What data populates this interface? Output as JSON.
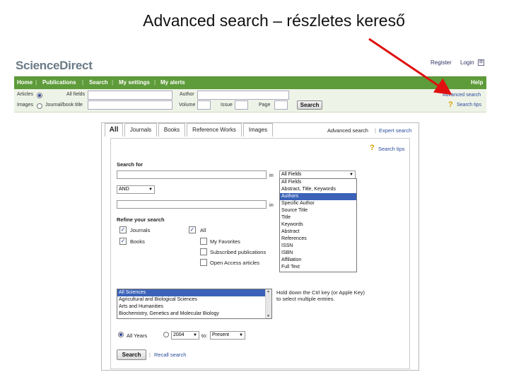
{
  "slide_title": "Advanced search – részletes kereső",
  "brand": {
    "logo_text": "ScienceDirect"
  },
  "top_links": {
    "register": "Register",
    "login": "Login"
  },
  "nav": {
    "items": [
      "Home",
      "Publications",
      "Search",
      "My settings",
      "My alerts"
    ],
    "help": "Help"
  },
  "quick_search": {
    "articles_label": "Articles",
    "images_label": "Images",
    "all_fields_label": "All fields",
    "journal_label": "Journal/book title",
    "author_label": "Author",
    "volume_label": "Volume",
    "issue_label": "Issue",
    "page_label": "Page",
    "search_button": "Search",
    "advanced_search_link": "Advanced search",
    "search_tips_link": "Search tips"
  },
  "tabs": [
    "All",
    "Journals",
    "Books",
    "Reference Works",
    "Images"
  ],
  "right_links": {
    "advanced": "Advanced search",
    "expert": "Expert search"
  },
  "form": {
    "search_tips": "Search tips",
    "search_for_label": "Search for",
    "in_label_1": "in",
    "in_label_2": "in",
    "field_select_value": "All Fields",
    "operator_value": "AND",
    "field_options": [
      "All Fields",
      "Abstract, Title, Keywords",
      "Authors",
      "Specific Author",
      "Source Title",
      "Title",
      "Keywords",
      "Abstract",
      "References",
      "ISSN",
      "ISBN",
      "Affiliation",
      "Full Text"
    ],
    "selected_field_index": 2,
    "refine_label": "Refine your search",
    "journals_label": "Journals",
    "books_label": "Books",
    "all_label": "All",
    "my_favorites_label": "My Favorites",
    "subscribed_label": "Subscribed publications",
    "open_access_label": "Open Access articles",
    "subjects": [
      "All Sciences",
      "Agricultural and Biological Sciences",
      "Arts and Humanities",
      "Biochemistry, Genetics and Molecular Biology"
    ],
    "hold_note_1": "Hold down the Ctrl key (or Apple Key)",
    "hold_note_2": "to select multiple entries.",
    "all_years_label": "All Years",
    "year_from": "2004",
    "to_label": "to:",
    "year_to": "Present",
    "search_button": "Search",
    "recall_link": "Recall search"
  },
  "colors": {
    "nav_green": "#5e9b3a",
    "arrow_red": "#e01010",
    "selection_blue": "#3b62b8"
  }
}
